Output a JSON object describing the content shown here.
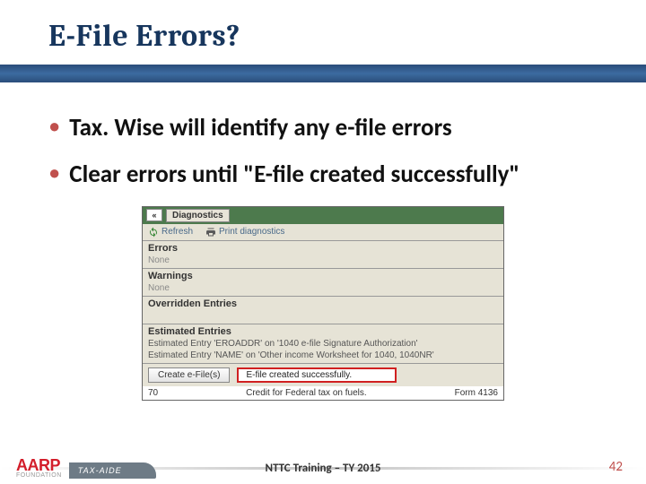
{
  "title": "E-File Errors?",
  "bullets": [
    "Tax. Wise will identify any e-file errors",
    "Clear errors until \"E-file created successfully\""
  ],
  "screenshot": {
    "nav_back": "«",
    "tab_label": "Diagnostics",
    "toolbar": {
      "refresh": "Refresh",
      "print": "Print diagnostics"
    },
    "sections": {
      "errors_head": "Errors",
      "errors_val": "None",
      "warnings_head": "Warnings",
      "warnings_val": "None",
      "overridden_head": "Overridden Entries",
      "estimated_head": "Estimated Entries",
      "est_line1": "Estimated Entry 'EROADDR' on '1040 e-file Signature Authorization'",
      "est_line2": "Estimated Entry 'NAME' on 'Other income Worksheet for 1040, 1040NR'"
    },
    "button": "Create e-File(s)",
    "success_msg": "E-file created successfully.",
    "bottom_left": "70",
    "bottom_mid": "Credit for Federal tax on fuels.",
    "bottom_right": "Form 4136"
  },
  "brand": {
    "logo": "AARP",
    "sub": "FOUNDATION",
    "pill": "TAX-AIDE"
  },
  "footer_text": "NTTC Training – TY 2015",
  "page_number": "42"
}
